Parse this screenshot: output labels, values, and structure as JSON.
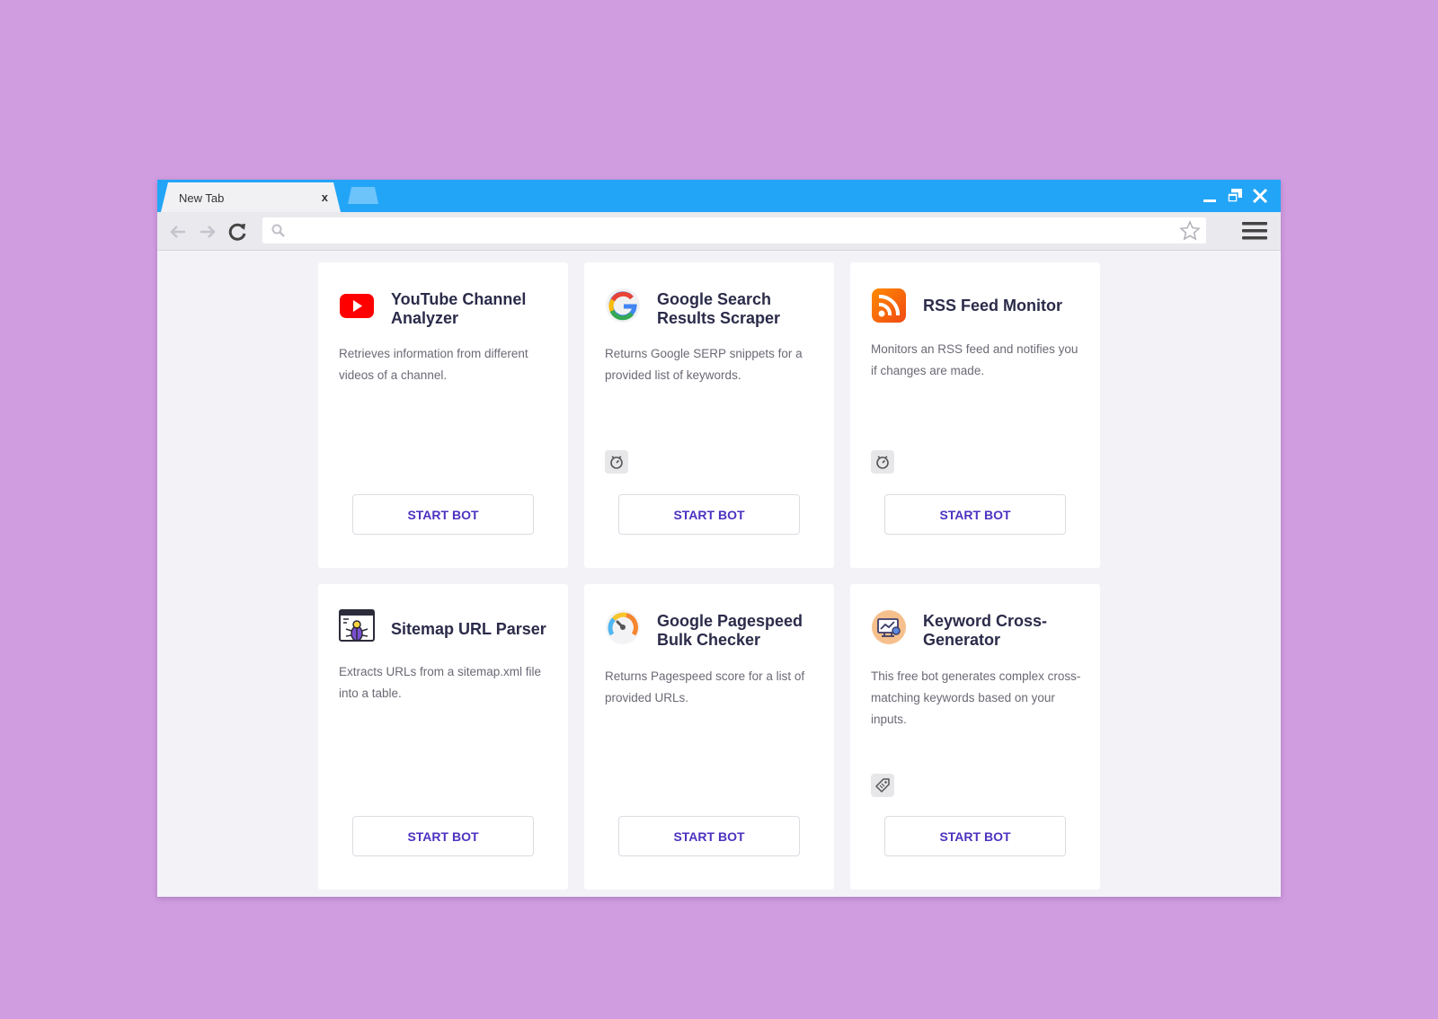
{
  "browser": {
    "tab_title": "New Tab",
    "tab_close": "x",
    "address_placeholder": "",
    "icons": [
      "back-arrow-icon",
      "forward-arrow-icon",
      "reload-icon",
      "search-icon",
      "star-icon",
      "hamburger-menu-icon",
      "minimize-icon",
      "maximize-icon",
      "close-icon"
    ],
    "colors": {
      "tabbar": "#22a5f7",
      "toolbar": "#e9e9ee",
      "page_bg": "#d09de0",
      "button_text": "#4d32c0"
    }
  },
  "cards": [
    {
      "title": "YouTube Channel Analyzer",
      "description": "Retrieves information from different videos of a channel.",
      "icon": "youtube-icon",
      "badge": null,
      "button": "START BOT"
    },
    {
      "title": "Google Search Results Scraper",
      "description": "Returns Google SERP snippets for a provided list of keywords.",
      "icon": "google-icon",
      "badge": "stopwatch-icon",
      "button": "START BOT"
    },
    {
      "title": "RSS Feed Monitor",
      "description": "Monitors an RSS feed and notifies you if changes are made.",
      "icon": "rss-icon",
      "badge": "stopwatch-icon",
      "button": "START BOT"
    },
    {
      "title": "Sitemap URL Parser",
      "description": "Extracts URLs from a sitemap.xml file into a table.",
      "icon": "bug-icon",
      "badge": null,
      "button": "START BOT"
    },
    {
      "title": "Google Pagespeed Bulk Checker",
      "description": "Returns Pagespeed score for a list of provided URLs.",
      "icon": "speedometer-icon",
      "badge": null,
      "button": "START BOT"
    },
    {
      "title": "Keyword Cross-Generator",
      "description": "This free bot generates complex cross-matching keywords based on your inputs.",
      "icon": "keyword-generator-icon",
      "badge": "tag-icon",
      "button": "START BOT"
    }
  ]
}
